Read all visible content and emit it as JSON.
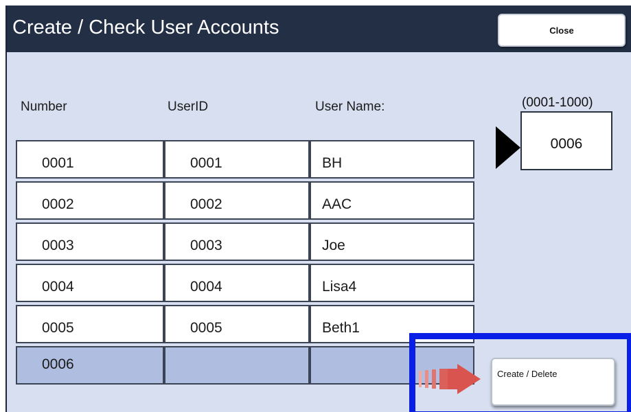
{
  "window": {
    "title": "Create / Check User Accounts",
    "close_label": "Close"
  },
  "table": {
    "headers": [
      "Number",
      "UserID",
      "User Name:"
    ],
    "rows": [
      {
        "number": "0001",
        "userid": "0001",
        "name": "BH"
      },
      {
        "number": "0002",
        "userid": "0002",
        "name": "AAC"
      },
      {
        "number": "0003",
        "userid": "0003",
        "name": "Joe"
      },
      {
        "number": "0004",
        "userid": "0004",
        "name": "Lisa4"
      },
      {
        "number": "0005",
        "userid": "0005",
        "name": "Beth1"
      },
      {
        "number": "0006",
        "userid": "",
        "name": ""
      }
    ],
    "selected_index": 5
  },
  "number_entry": {
    "range_label": "(0001-1000)",
    "value": "0006",
    "pointer_icon": "triangle-right-icon"
  },
  "actions": {
    "create_delete_label": "Create / Delete",
    "arrow_icon": "arrow-right-icon"
  },
  "colors": {
    "titlebar": "#222f45",
    "background": "#d8dff0",
    "selected_row": "#aebde0",
    "highlight_box": "#0a1fe6",
    "arrow": "#d9534f"
  }
}
